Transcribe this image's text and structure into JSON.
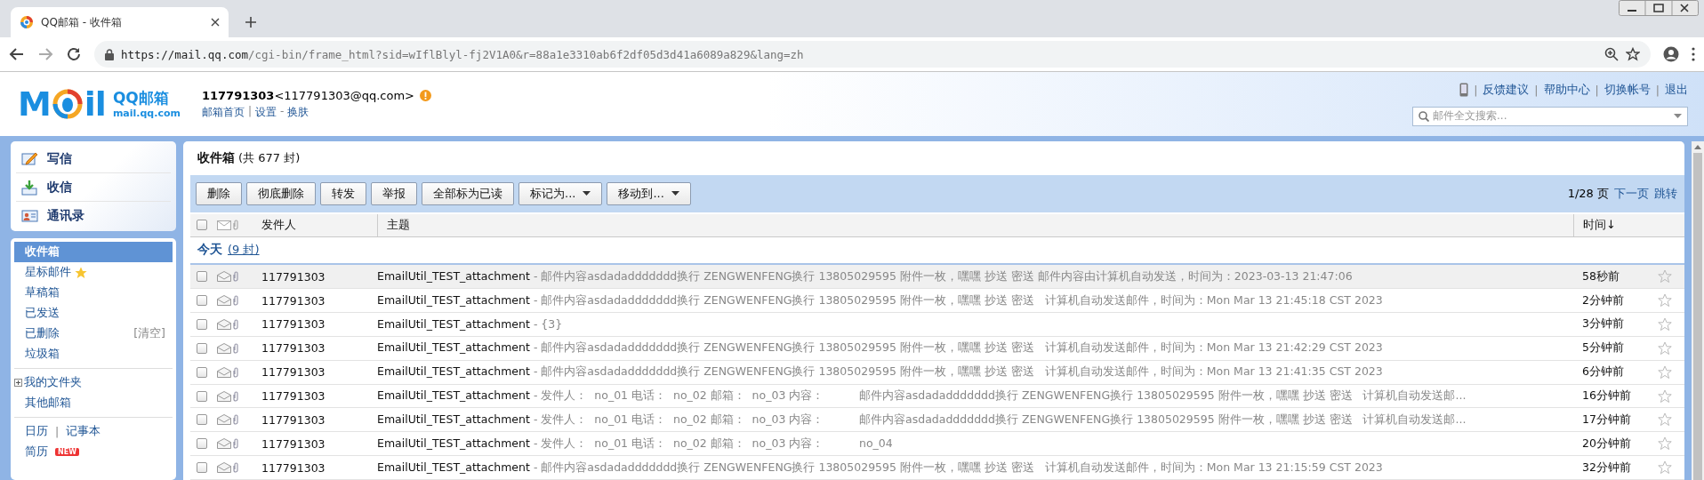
{
  "browser": {
    "tab_title": "QQ邮箱 - 收件箱",
    "url_host": "https://mail.qq.com",
    "url_path": "/cgi-bin/frame_html?sid=wIflBlyl-fj2V1A0&r=88a1e3310ab6f2df05d3d41a6089a829&lang=zh"
  },
  "header": {
    "logo": {
      "left": "M",
      "right": "il",
      "name": "QQ邮箱",
      "domain": "mail.qq.com"
    },
    "account": {
      "name": "117791303",
      "email": "<117791303@qq.com>"
    },
    "nav": [
      {
        "kind": "link",
        "text": "邮箱首页"
      },
      {
        "kind": "sep",
        "text": "|"
      },
      {
        "kind": "link",
        "text": "设置"
      },
      {
        "kind": "sep",
        "text": "-"
      },
      {
        "kind": "link",
        "text": "换肤"
      }
    ],
    "top_links": [
      {
        "kind": "phone"
      },
      {
        "kind": "sep",
        "text": "|"
      },
      {
        "kind": "link",
        "text": "反馈建议"
      },
      {
        "kind": "sep",
        "text": "|"
      },
      {
        "kind": "link",
        "text": "帮助中心"
      },
      {
        "kind": "sep",
        "text": "|"
      },
      {
        "kind": "link",
        "text": "切换帐号"
      },
      {
        "kind": "sep",
        "text": "|"
      },
      {
        "kind": "link",
        "text": "退出"
      }
    ],
    "search": {
      "placeholder": "邮件全文搜索..."
    }
  },
  "sidebar": {
    "actions": [
      {
        "kind": "compose",
        "label": "写信"
      },
      {
        "kind": "receive",
        "label": "收信"
      },
      {
        "kind": "contacts",
        "label": "通讯录"
      }
    ],
    "folders": [
      {
        "label": "收件箱",
        "selected": true
      },
      {
        "label": "星标邮件",
        "selected": false,
        "starred": true
      },
      {
        "label": "草稿箱",
        "selected": false
      },
      {
        "label": "已发送",
        "selected": false
      },
      {
        "label": "已删除",
        "selected": false,
        "action": "[清空]"
      },
      {
        "label": "垃圾箱",
        "selected": false
      }
    ],
    "my_folders": {
      "label": "我的文件夹",
      "expanded": false
    },
    "other": {
      "label": "其他邮箱"
    },
    "tools": [
      {
        "kind": "link",
        "text": "日历"
      },
      {
        "kind": "sep",
        "text": "|"
      },
      {
        "kind": "link",
        "text": "记事本"
      }
    ],
    "resume": {
      "label": "简历",
      "badge": "NEW"
    }
  },
  "mailbox": {
    "title": "收件箱",
    "count": "(共 677 封)",
    "toolbar": [
      {
        "kind": "button",
        "label": "删除"
      },
      {
        "kind": "button",
        "label": "彻底删除"
      },
      {
        "kind": "button",
        "label": "转发"
      },
      {
        "kind": "button",
        "label": "举报"
      },
      {
        "kind": "button",
        "label": "全部标为已读"
      },
      {
        "kind": "dropdown",
        "label": "标记为..."
      },
      {
        "kind": "dropdown",
        "label": "移动到..."
      }
    ],
    "pager": {
      "page": "1/28 页",
      "next": "下一页",
      "jump": "跳转"
    },
    "columns": {
      "select_all_checked": false,
      "sender": "发件人",
      "subject": "主题",
      "time": "时间↓"
    },
    "group": {
      "label": "今天",
      "count": "(9 封)"
    },
    "rows": [
      {
        "sender": "117791303",
        "subject": "EmailUtil_TEST_attachment",
        "summary": "- 邮件内容asdadaddddddd换行 ZENGWENFENG换行 13805029595 附件一枚，嘿嘿 抄送 密送 邮件内容由计算机自动发送，时间为：2023-03-13 21:47:06",
        "time": "58秒前",
        "hovered": true,
        "checked": false,
        "starred": false
      },
      {
        "sender": "117791303",
        "subject": "EmailUtil_TEST_attachment",
        "summary": "- 邮件内容asdadaddddddd换行 ZENGWENFENG换行 13805029595 附件一枚，嘿嘿 抄送 密送   计算机自动发送邮件，时间为：Mon Mar 13 21:45:18 CST 2023",
        "time": "2分钟前",
        "hovered": false,
        "checked": false,
        "starred": false
      },
      {
        "sender": "117791303",
        "subject": "EmailUtil_TEST_attachment",
        "summary": "- {3}",
        "time": "3分钟前",
        "hovered": false,
        "checked": false,
        "starred": false
      },
      {
        "sender": "117791303",
        "subject": "EmailUtil_TEST_attachment",
        "summary": "- 邮件内容asdadaddddddd换行 ZENGWENFENG换行 13805029595 附件一枚，嘿嘿 抄送 密送   计算机自动发送邮件，时间为：Mon Mar 13 21:42:29 CST 2023",
        "time": "5分钟前",
        "hovered": false,
        "checked": false,
        "starred": false
      },
      {
        "sender": "117791303",
        "subject": "EmailUtil_TEST_attachment",
        "summary": "- 邮件内容asdadaddddddd换行 ZENGWENFENG换行 13805029595 附件一枚，嘿嘿 抄送 密送   计算机自动发送邮件，时间为：Mon Mar 13 21:41:35 CST 2023",
        "time": "6分钟前",
        "hovered": false,
        "checked": false,
        "starred": false
      },
      {
        "sender": "117791303",
        "subject": "EmailUtil_TEST_attachment",
        "summary": "- 发件人：  no_01 电话：  no_02 邮箱：  no_03 内容：          邮件内容asdadaddddddd换行 ZENGWENFENG换行 13805029595 附件一枚，嘿嘿 抄送 密送   计算机自动发送邮...",
        "time": "16分钟前",
        "hovered": false,
        "checked": false,
        "starred": false
      },
      {
        "sender": "117791303",
        "subject": "EmailUtil_TEST_attachment",
        "summary": "- 发件人：  no_01 电话：  no_02 邮箱：  no_03 内容：          邮件内容asdadaddddddd换行 ZENGWENFENG换行 13805029595 附件一枚，嘿嘿 抄送 密送   计算机自动发送邮...",
        "time": "17分钟前",
        "hovered": false,
        "checked": false,
        "starred": false
      },
      {
        "sender": "117791303",
        "subject": "EmailUtil_TEST_attachment",
        "summary": "- 发件人：  no_01 电话：  no_02 邮箱：  no_03 内容：          no_04",
        "time": "20分钟前",
        "hovered": false,
        "checked": false,
        "starred": false
      },
      {
        "sender": "117791303",
        "subject": "EmailUtil_TEST_attachment",
        "summary": "- 邮件内容asdadaddddddd换行 ZENGWENFENG换行 13805029595 附件一枚，嘿嘿 抄送 密送   计算机自动发送邮件，时间为：Mon Mar 13 21:15:59 CST 2023",
        "time": "32分钟前",
        "hovered": false,
        "checked": false,
        "starred": false
      }
    ]
  }
}
